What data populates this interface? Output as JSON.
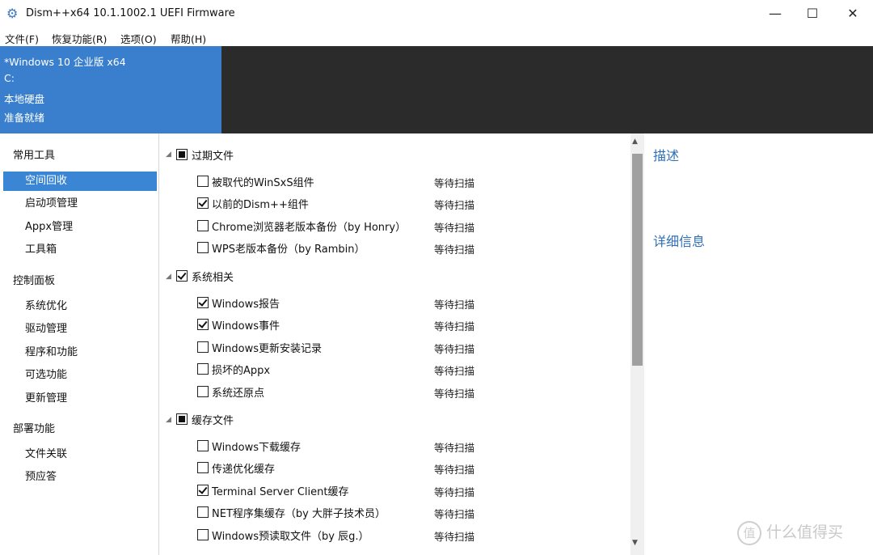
{
  "window": {
    "title": "Dism++x64 10.1.1002.1 UEFI Firmware",
    "app_icon": "gear-icon",
    "minimize_glyph": "—",
    "maximize_glyph": "☐",
    "close_glyph": "✕"
  },
  "menu": [
    "文件(F)",
    "恢复功能(R)",
    "选项(O)",
    "帮助(H)"
  ],
  "os_info": {
    "name": "*Windows 10 企业版 x64",
    "drive": "C:",
    "disk": "本地硬盘",
    "status": "准备就绪"
  },
  "sidebar": {
    "groups": [
      {
        "label": "常用工具",
        "items": [
          "空间回收",
          "启动项管理",
          "Appx管理",
          "工具箱"
        ]
      },
      {
        "label": "控制面板",
        "items": [
          "系统优化",
          "驱动管理",
          "程序和功能",
          "可选功能",
          "更新管理"
        ]
      },
      {
        "label": "部署功能",
        "items": [
          "文件关联",
          "预应答"
        ]
      }
    ],
    "selected": "空间回收"
  },
  "cleanup": {
    "groups": [
      {
        "label": "过期文件",
        "state": "partial",
        "items": [
          {
            "label": "被取代的WinSxS组件",
            "checked": false,
            "status": "等待扫描"
          },
          {
            "label": "以前的Dism++组件",
            "checked": true,
            "status": "等待扫描"
          },
          {
            "label": "Chrome浏览器老版本备份（by Honry）",
            "checked": false,
            "status": "等待扫描"
          },
          {
            "label": "WPS老版本备份（by Rambin）",
            "checked": false,
            "status": "等待扫描"
          }
        ]
      },
      {
        "label": "系统相关",
        "state": "checked",
        "items": [
          {
            "label": "Windows报告",
            "checked": true,
            "status": "等待扫描"
          },
          {
            "label": "Windows事件",
            "checked": true,
            "status": "等待扫描"
          },
          {
            "label": "Windows更新安装记录",
            "checked": false,
            "status": "等待扫描"
          },
          {
            "label": "损坏的Appx",
            "checked": false,
            "status": "等待扫描"
          },
          {
            "label": "系统还原点",
            "checked": false,
            "status": "等待扫描"
          }
        ]
      },
      {
        "label": "缓存文件",
        "state": "partial",
        "items": [
          {
            "label": "Windows下载缓存",
            "checked": false,
            "status": "等待扫描"
          },
          {
            "label": "传递优化缓存",
            "checked": false,
            "status": "等待扫描"
          },
          {
            "label": "Terminal Server Client缓存",
            "checked": true,
            "status": "等待扫描"
          },
          {
            "label": "NET程序集缓存（by 大胖子技术员）",
            "checked": false,
            "status": "等待扫描"
          },
          {
            "label": "Windows预读取文件（by 辰g.）",
            "checked": false,
            "status": "等待扫描"
          }
        ]
      }
    ]
  },
  "detail_pane": {
    "description_title": "描述",
    "details_title": "详细信息"
  },
  "watermark": {
    "icon": "watermark-logo-icon",
    "glyph": "值",
    "text": "什么值得买"
  },
  "colors": {
    "accent": "#3a86d4",
    "os_panel": "#3a7fcd",
    "header_dark": "#2b2b2b",
    "pane_heading": "#2f6fb8"
  }
}
